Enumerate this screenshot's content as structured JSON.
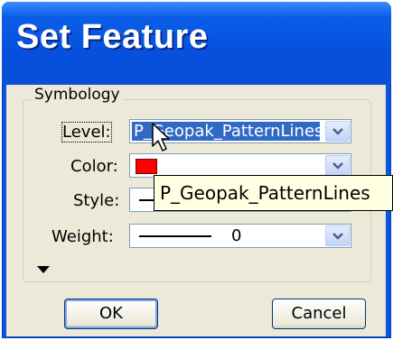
{
  "window": {
    "title": "Set Feature"
  },
  "group": {
    "label": "Symbology"
  },
  "fields": {
    "level": {
      "label": "Level:",
      "value": "P_Geopak_PatternLines"
    },
    "color": {
      "label": "Color:",
      "swatch_color": "#ff0000"
    },
    "style": {
      "label": "Style:"
    },
    "weight": {
      "label": "Weight:",
      "value": "0"
    }
  },
  "buttons": {
    "ok": "OK",
    "cancel": "Cancel"
  },
  "tooltip": {
    "text": "P_Geopak_PatternLines"
  },
  "icons": {
    "dropdown": "chevron-down-icon",
    "expander": "triangle-down-icon",
    "cursor": "mouse-pointer-icon"
  },
  "colors": {
    "title_bar": "#0a56e0",
    "selection": "#316ac5",
    "dialog_bg": "#ece9d8",
    "tooltip_bg": "#ffffe1"
  }
}
